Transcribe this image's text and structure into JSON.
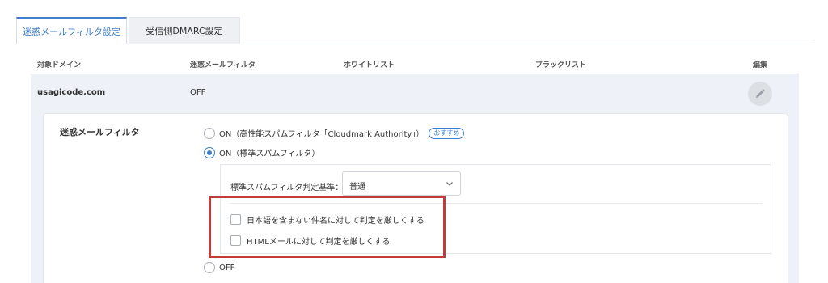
{
  "tabs": [
    {
      "label": "迷惑メールフィルタ設定",
      "active": true
    },
    {
      "label": "受信側DMARC設定",
      "active": false
    }
  ],
  "table": {
    "headers": {
      "domain": "対象ドメイン",
      "spam_filter": "迷惑メールフィルタ",
      "whitelist": "ホワイトリスト",
      "blacklist": "ブラックリスト",
      "edit": "編集"
    },
    "row": {
      "domain": "usagicode.com",
      "spam_filter": "OFF",
      "edit_icon": "pencil-icon"
    }
  },
  "settings": {
    "label": "迷惑メールフィルタ",
    "options": [
      {
        "label": "ON（高性能スパムフィルタ「Cloudmark Authority」）",
        "badge": "おすすめ",
        "checked": false
      },
      {
        "label": "ON（標準スパムフィルタ）",
        "checked": true
      },
      {
        "label": "OFF",
        "checked": false
      }
    ],
    "standard": {
      "level_label": "標準スパムフィルタ判定基準：",
      "level_value": "普通",
      "checkboxes": [
        {
          "label": "日本語を含まない件名に対して判定を厳しくする",
          "checked": false
        },
        {
          "label": "HTMLメールに対して判定を厳しくする",
          "checked": false
        }
      ]
    }
  },
  "colors": {
    "accent": "#3f7fc9",
    "highlight": "#c33a3a",
    "row_bg": "#eef1f7"
  }
}
